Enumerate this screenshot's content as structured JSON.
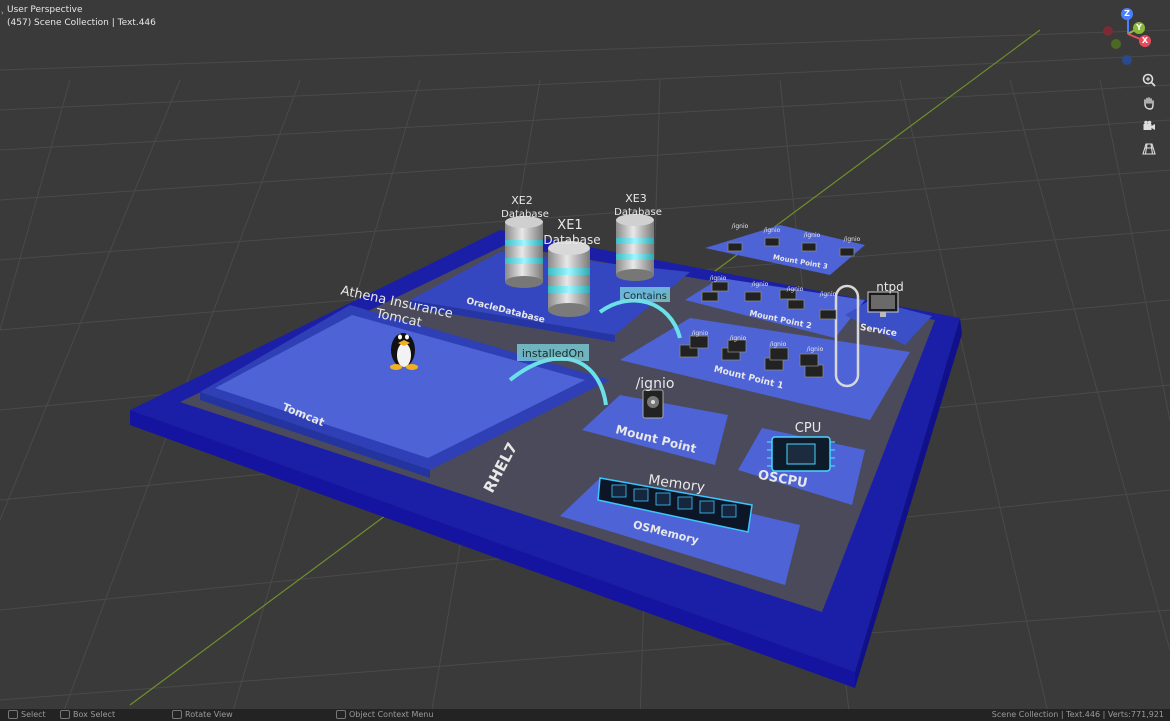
{
  "viewport": {
    "mode": "User Perspective",
    "collection": "(457) Scene Collection | Text.446"
  },
  "gizmo": {
    "z": "Z",
    "y": "Y",
    "x": "X"
  },
  "nav_icons": [
    "zoom-icon",
    "hand-pan-icon",
    "camera-icon",
    "grid-perspective-icon"
  ],
  "scene_labels": {
    "xe2_title": "XE2",
    "xe1_title": "XE1",
    "xe3_title": "XE3",
    "database": "Database",
    "athena_line1": "Athena Insurance",
    "athena_line2": "Tomcat",
    "tomcat_base": "Tomcat",
    "oracle_base": "OracleDatabase",
    "contains": "Contains",
    "installedon": "installedOn",
    "ignio_path": "/ignio",
    "ignio_small": "/ignio",
    "mount_point": "Mount Point",
    "mount_point_1": "Mount Point 1",
    "mount_point_2": "Mount Point 2",
    "mount_point_3": "Mount Point 3",
    "ntpd": "ntpd",
    "service": "Service",
    "cpu": "CPU",
    "oscpu": "OSCPU",
    "memory": "Memory",
    "osmemory": "OSMemory",
    "rhel": "RHEL7"
  },
  "statusbar": {
    "select": "Select",
    "box_select": "Box Select",
    "rotate": "Rotate View",
    "context": "Object Context Menu",
    "stats": "Scene Collection | Text.446 | Verts:771,921"
  }
}
